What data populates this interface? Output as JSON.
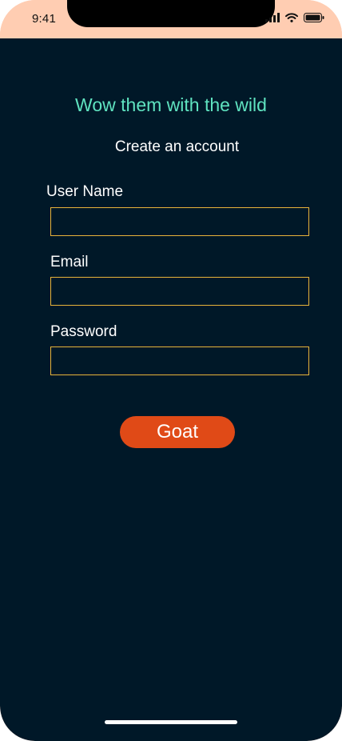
{
  "status_bar": {
    "time": "9:41",
    "icons": [
      "signal-icon",
      "wifi-icon",
      "battery-icon"
    ]
  },
  "form": {
    "headline": "Wow them with the wild",
    "subtitle": "Create an account",
    "fields": [
      {
        "label": "User Name",
        "value": "",
        "placeholder": ""
      },
      {
        "label": "Email",
        "value": "",
        "placeholder": ""
      },
      {
        "label": "Password",
        "value": "",
        "placeholder": ""
      }
    ],
    "submit_label": "Goat"
  },
  "colors": {
    "status_bar_bg": "#ffcdb2",
    "background": "#001828",
    "headline": "#5fe3c0",
    "field_border": "#e8b33a",
    "button": "#e04a17"
  }
}
